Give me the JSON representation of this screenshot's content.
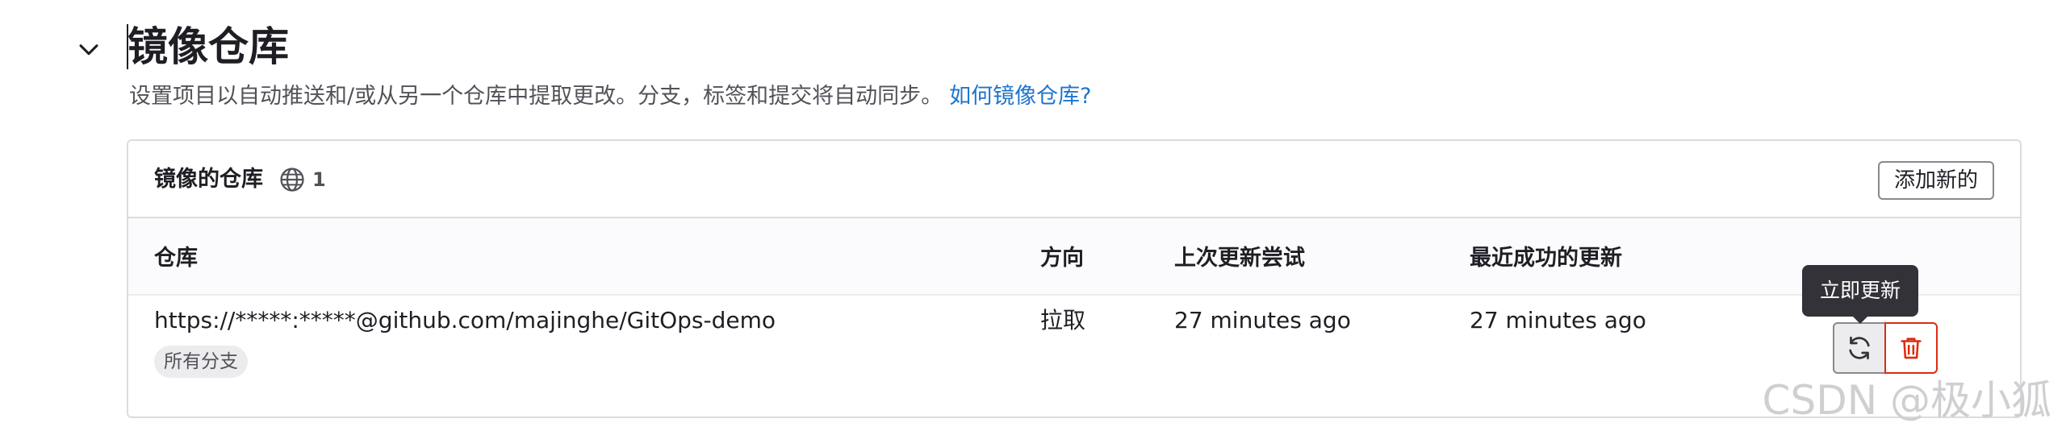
{
  "section": {
    "title": "镜像仓库",
    "description": "设置项目以自动推送和/或从另一个仓库中提取更改。分支，标签和提交将自动同步。",
    "help_link": "如何镜像仓库?"
  },
  "card": {
    "title": "镜像的仓库",
    "count": "1",
    "add_button": "添加新的"
  },
  "table": {
    "headers": {
      "repo": "仓库",
      "direction": "方向",
      "last_attempt": "上次更新尝试",
      "last_success": "最近成功的更新"
    },
    "rows": [
      {
        "repo": "https://*****:*****@github.com/majinghe/GitOps-demo",
        "branches_badge": "所有分支",
        "direction": "拉取",
        "last_attempt": "27 minutes ago",
        "last_success": "27 minutes ago"
      }
    ]
  },
  "tooltip": "立即更新",
  "watermark": "CSDN @极小狐",
  "icons": {
    "collapse": "chevron-down-icon",
    "visibility": "globe-icon",
    "sync": "retry-icon",
    "delete": "trash-icon"
  },
  "colors": {
    "link": "#1f75cb",
    "danger": "#dd2b0e",
    "tooltip_bg": "#333238"
  }
}
